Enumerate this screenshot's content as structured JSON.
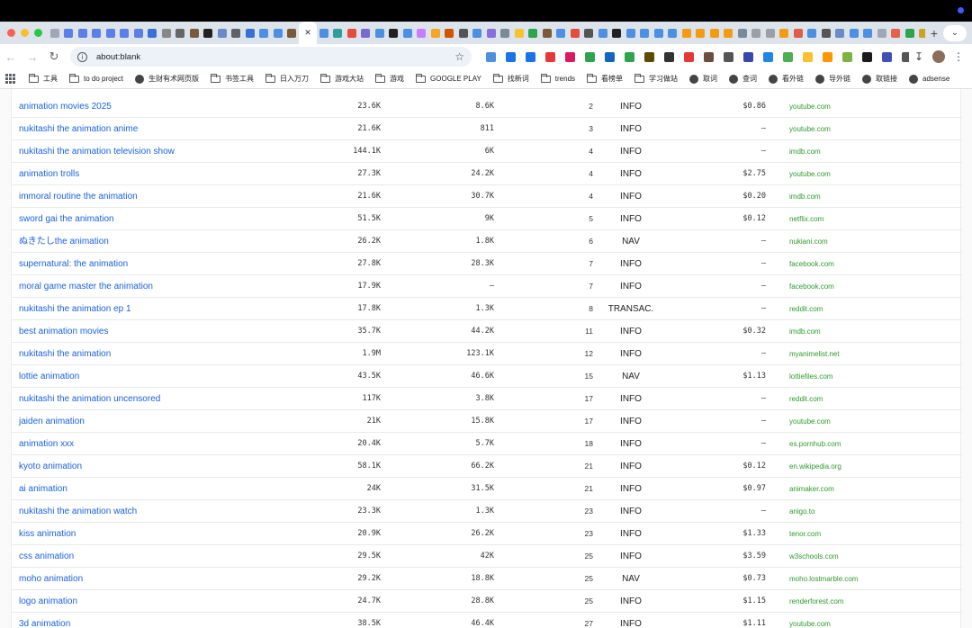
{
  "browser": {
    "url": "about:blank",
    "tab_close_glyph": "✕",
    "new_tab_glyph": "+",
    "tab_menu_glyph": "⌄",
    "tab_favicon_colors": [
      "#a0a7b8",
      "#5b7fe6",
      "#5b7fe6",
      "#5b7fe6",
      "#5b7fe6",
      "#5b7fe6",
      "#5b7fe6",
      "#3b6fd8",
      "#888888",
      "#666666",
      "#7a5a3a",
      "#222222",
      "#6a8ac9",
      "#5f6368",
      "#3b6fd8",
      "#4d8fe0",
      "#4d8fe0",
      "#7a5a3a",
      "#4d8fe0",
      "#2f9e9a",
      "#e34d3b",
      "#7a6ad0",
      "#4d8fe0",
      "#222222",
      "#4d8fe0",
      "#c77dff",
      "#f5a623",
      "#d35400",
      "#555555",
      "#4d8fe0",
      "#8a6ddf",
      "#7a8a9a",
      "#f4c430",
      "#2ea44f",
      "#7a5a3a",
      "#4d8fe0",
      "#e34d3b",
      "#555555",
      "#4d8fe0",
      "#222222",
      "#4d8fe0",
      "#4d8fe0",
      "#4d8fe0",
      "#4d8fe0",
      "#f39c12",
      "#f39c12",
      "#f39c12",
      "#f39c12",
      "#7a8a9a",
      "#9aa0a6",
      "#9aa0a6",
      "#f39c12",
      "#e05d4a",
      "#4d8fe0",
      "#555555",
      "#6a8ac9",
      "#4d8fe0",
      "#4d8fe0",
      "#a0a7b8",
      "#e8604c",
      "#2ea44f",
      "#c9a227",
      "#e34d3b",
      "#2ea44f",
      "#e34d3b",
      "#2ea44f"
    ],
    "extension_colors": [
      "#4d8fe0",
      "#1a73e8",
      "#1a73e8",
      "#e53935",
      "#d81b60",
      "#2ea44f",
      "#1565c0",
      "#2ea44f",
      "#5f4b00",
      "#333333",
      "#e53935",
      "#6d4c41",
      "#555555",
      "#3949ab",
      "#1e88e5",
      "#4caf50",
      "#fbc02d",
      "#ff9800",
      "#7cb342",
      "#1b1b1b",
      "#3f51b5",
      "#555555"
    ]
  },
  "bookmarks": [
    {
      "type": "folder",
      "label": "工具"
    },
    {
      "type": "folder",
      "label": "to do project"
    },
    {
      "type": "site",
      "label": "生财有术网页版"
    },
    {
      "type": "folder",
      "label": "书签工具"
    },
    {
      "type": "folder",
      "label": "日入万刀"
    },
    {
      "type": "folder",
      "label": "游戏大站"
    },
    {
      "type": "folder",
      "label": "游戏"
    },
    {
      "type": "folder",
      "label": "GOOGLE PLAY"
    },
    {
      "type": "folder",
      "label": "找新词"
    },
    {
      "type": "folder",
      "label": "trends"
    },
    {
      "type": "folder",
      "label": "看榜单"
    },
    {
      "type": "folder",
      "label": "学习做站"
    },
    {
      "type": "site",
      "label": "取词"
    },
    {
      "type": "site",
      "label": "查词"
    },
    {
      "type": "site",
      "label": "看外链"
    },
    {
      "type": "site",
      "label": "导外链"
    },
    {
      "type": "site",
      "label": "取链接"
    },
    {
      "type": "site",
      "label": "adsense"
    }
  ],
  "rows": [
    {
      "keyword": "animation movies 2025",
      "volume": "23.6K",
      "results": "8.6K",
      "position": "2",
      "intent": "INFO",
      "cpc": "$0.86",
      "domain": "youtube.com"
    },
    {
      "keyword": "nukitashi the animation anime",
      "volume": "21.6K",
      "results": "811",
      "position": "3",
      "intent": "INFO",
      "cpc": "—",
      "domain": "youtube.com"
    },
    {
      "keyword": "nukitashi the animation television show",
      "volume": "144.1K",
      "results": "6K",
      "position": "4",
      "intent": "INFO",
      "cpc": "—",
      "domain": "imdb.com"
    },
    {
      "keyword": "animation trolls",
      "volume": "27.3K",
      "results": "24.2K",
      "position": "4",
      "intent": "INFO",
      "cpc": "$2.75",
      "domain": "youtube.com"
    },
    {
      "keyword": "immoral routine the animation",
      "volume": "21.6K",
      "results": "30.7K",
      "position": "4",
      "intent": "INFO",
      "cpc": "$0.20",
      "domain": "imdb.com"
    },
    {
      "keyword": "sword gai the animation",
      "volume": "51.5K",
      "results": "9K",
      "position": "5",
      "intent": "INFO",
      "cpc": "$0.12",
      "domain": "netflix.com"
    },
    {
      "keyword": "ぬきたしthe animation",
      "volume": "26.2K",
      "results": "1.8K",
      "position": "6",
      "intent": "NAV",
      "cpc": "—",
      "domain": "nukiani.com"
    },
    {
      "keyword": "supernatural: the animation",
      "volume": "27.8K",
      "results": "28.3K",
      "position": "7",
      "intent": "INFO",
      "cpc": "—",
      "domain": "facebook.com"
    },
    {
      "keyword": "moral game master the animation",
      "volume": "17.9K",
      "results": "—",
      "position": "7",
      "intent": "INFO",
      "cpc": "—",
      "domain": "facebook.com"
    },
    {
      "keyword": "nukitashi the animation ep 1",
      "volume": "17.8K",
      "results": "1.3K",
      "position": "8",
      "intent": "TRANSAC.",
      "cpc": "—",
      "domain": "reddit.com"
    },
    {
      "keyword": "best animation movies",
      "volume": "35.7K",
      "results": "44.2K",
      "position": "11",
      "intent": "INFO",
      "cpc": "$0.32",
      "domain": "imdb.com"
    },
    {
      "keyword": "nukitashi the animation",
      "volume": "1.9M",
      "results": "123.1K",
      "position": "12",
      "intent": "INFO",
      "cpc": "—",
      "domain": "myanimelist.net"
    },
    {
      "keyword": "lottie animation",
      "volume": "43.5K",
      "results": "46.6K",
      "position": "15",
      "intent": "NAV",
      "cpc": "$1.13",
      "domain": "lottiefiles.com"
    },
    {
      "keyword": "nukitashi the animation uncensored",
      "volume": "117K",
      "results": "3.8K",
      "position": "17",
      "intent": "INFO",
      "cpc": "—",
      "domain": "reddit.com"
    },
    {
      "keyword": "jaiden animation",
      "volume": "21K",
      "results": "15.8K",
      "position": "17",
      "intent": "INFO",
      "cpc": "—",
      "domain": "youtube.com"
    },
    {
      "keyword": "animation xxx",
      "volume": "20.4K",
      "results": "5.7K",
      "position": "18",
      "intent": "INFO",
      "cpc": "—",
      "domain": "es.pornhub.com"
    },
    {
      "keyword": "kyoto animation",
      "volume": "58.1K",
      "results": "66.2K",
      "position": "21",
      "intent": "INFO",
      "cpc": "$0.12",
      "domain": "en.wikipedia.org"
    },
    {
      "keyword": "ai animation",
      "volume": "24K",
      "results": "31.5K",
      "position": "21",
      "intent": "INFO",
      "cpc": "$0.97",
      "domain": "animaker.com"
    },
    {
      "keyword": "nukitashi the animation watch",
      "volume": "23.3K",
      "results": "1.3K",
      "position": "23",
      "intent": "INFO",
      "cpc": "—",
      "domain": "anigo.to"
    },
    {
      "keyword": "kiss animation",
      "volume": "20.9K",
      "results": "26.2K",
      "position": "23",
      "intent": "INFO",
      "cpc": "$1.33",
      "domain": "tenor.com"
    },
    {
      "keyword": "css animation",
      "volume": "29.5K",
      "results": "42K",
      "position": "25",
      "intent": "INFO",
      "cpc": "$3.59",
      "domain": "w3schools.com"
    },
    {
      "keyword": "moho animation",
      "volume": "29.2K",
      "results": "18.8K",
      "position": "25",
      "intent": "NAV",
      "cpc": "$0.73",
      "domain": "moho.lostmarble.com"
    },
    {
      "keyword": "logo animation",
      "volume": "24.7K",
      "results": "28.8K",
      "position": "25",
      "intent": "INFO",
      "cpc": "$1.15",
      "domain": "renderforest.com"
    },
    {
      "keyword": "3d animation",
      "volume": "38.5K",
      "results": "46.4K",
      "position": "27",
      "intent": "INFO",
      "cpc": "$1.11",
      "domain": "youtube.com"
    }
  ]
}
